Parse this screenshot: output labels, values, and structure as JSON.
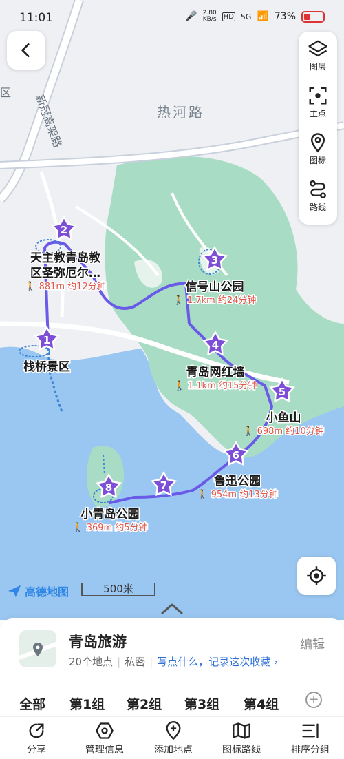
{
  "status_bar": {
    "time": "11:01",
    "net_speed": "2.80",
    "net_unit": "KB/s",
    "hd": "HD",
    "signal": "5G",
    "battery": "73%"
  },
  "map": {
    "road_labels": [
      "热河路",
      "新冠高架路",
      "区"
    ],
    "brand": "高德地图",
    "scale": "500米",
    "colors": {
      "water": "#9ac7f1",
      "land": "#eef0f3",
      "park": "#a9dcc5",
      "route": "#6a5ae8",
      "walk": "#e0564a"
    },
    "points": [
      {
        "num": "1",
        "name": "栈桥景区"
      },
      {
        "num": "2",
        "name": "天主教青岛教区圣弥厄尔…",
        "name_l1": "天主教青岛教",
        "name_l2": "区圣弥厄尔…",
        "walk": "881m 约12分钟"
      },
      {
        "num": "3",
        "name": "信号山公园",
        "walk": "1.7km 约24分钟"
      },
      {
        "num": "4",
        "name": "青岛网红墙",
        "walk": "1.1km 约15分钟"
      },
      {
        "num": "5",
        "name": "小鱼山",
        "walk": "698m 约10分钟"
      },
      {
        "num": "6",
        "name": "鲁迅公园",
        "walk": "954m 约13分钟"
      },
      {
        "num": "7"
      },
      {
        "num": "8",
        "name": "小青岛公园",
        "walk": "369m 约5分钟"
      }
    ]
  },
  "top_controls": {
    "back_icon": "chevron-left-icon",
    "tools": [
      {
        "icon": "layers-icon",
        "label": "图层"
      },
      {
        "icon": "focus-icon",
        "label": "主点"
      },
      {
        "icon": "map-pin-icon",
        "label": "图标"
      },
      {
        "icon": "route-icon",
        "label": "路线"
      }
    ]
  },
  "trip": {
    "title": "青岛旅游",
    "count": "20个地点",
    "privacy": "私密",
    "prompt": "写点什么，记录这次收藏 ›",
    "edit": "编辑"
  },
  "groups": [
    "全部",
    "第1组",
    "第2组",
    "第3组",
    "第4组"
  ],
  "tabs": [
    {
      "icon": "share-icon",
      "label": "分享"
    },
    {
      "icon": "manage-info-icon",
      "label": "管理信息"
    },
    {
      "icon": "add-location-icon",
      "label": "添加地点"
    },
    {
      "icon": "map-route-icon",
      "label": "图标路线"
    },
    {
      "icon": "sort-group-icon",
      "label": "排序分组"
    }
  ]
}
